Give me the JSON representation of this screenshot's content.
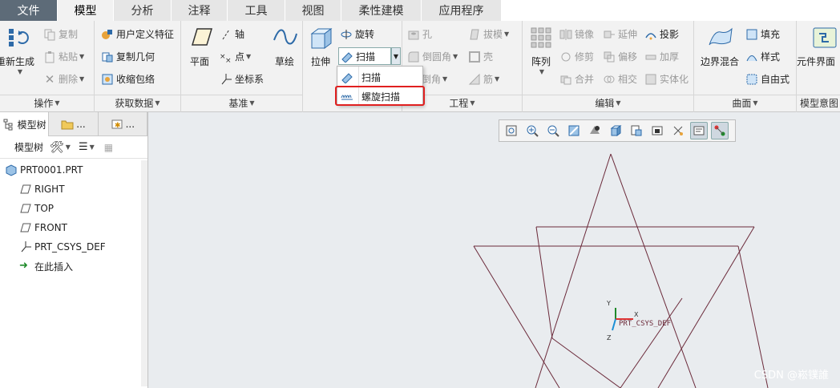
{
  "tabs": [
    "文件",
    "模型",
    "分析",
    "注释",
    "工具",
    "视图",
    "柔性建模",
    "应用程序"
  ],
  "groups": {
    "operations": {
      "label": "操作",
      "regenerate": "重新生成",
      "copy": "复制",
      "paste": "粘贴",
      "delete": "删除"
    },
    "get_data": {
      "label": "获取数据",
      "udf": "用户定义特征",
      "copy_geom": "复制几何",
      "shrinkwrap": "收缩包络"
    },
    "datum": {
      "label": "基准",
      "plane": "平面",
      "axis": "轴",
      "point": "点",
      "csys": "坐标系",
      "sketch": "草绘"
    },
    "shapes": {
      "extrude": "拉伸",
      "revolve": "旋转",
      "sweep": "扫描"
    },
    "engineering": {
      "label": "工程",
      "hole": "孔",
      "round": "倒圆角",
      "chamfer": "倒角",
      "draft": "拔模",
      "shell": "壳",
      "rib": "筋"
    },
    "editing": {
      "label": "编辑",
      "pattern": "阵列",
      "mirror": "镜像",
      "extend": "延伸",
      "project": "投影",
      "trim": "修剪",
      "offset": "偏移",
      "thicken": "加厚",
      "merge": "合并",
      "intersect": "相交",
      "solidify": "实体化"
    },
    "surfaces": {
      "label": "曲面",
      "boundary": "边界混合",
      "fill": "填充",
      "style": "样式",
      "freestyle": "自由式"
    },
    "intent": {
      "label": "模型意图",
      "component": "元件界面"
    }
  },
  "sweep_menu": {
    "sweep": "扫描",
    "helical": "螺旋扫描"
  },
  "left_panel": {
    "tab1": "模型树",
    "tab2": "...",
    "tab3": "...",
    "toolbar_label": "模型树",
    "tree": [
      "PRT0001.PRT",
      "RIGHT",
      "TOP",
      "FRONT",
      "PRT_CSYS_DEF",
      "在此插入"
    ]
  },
  "viewport": {
    "csys_label": "PRT_CSYS_DEF",
    "axis_x": "X",
    "axis_y": "Y",
    "axis_z": "Z",
    "watermark": "CSDN @崧镤誰"
  },
  "colors": {
    "accent": "#2d6aa8",
    "highlight": "#e02020",
    "datum": "#6b2a3a"
  }
}
